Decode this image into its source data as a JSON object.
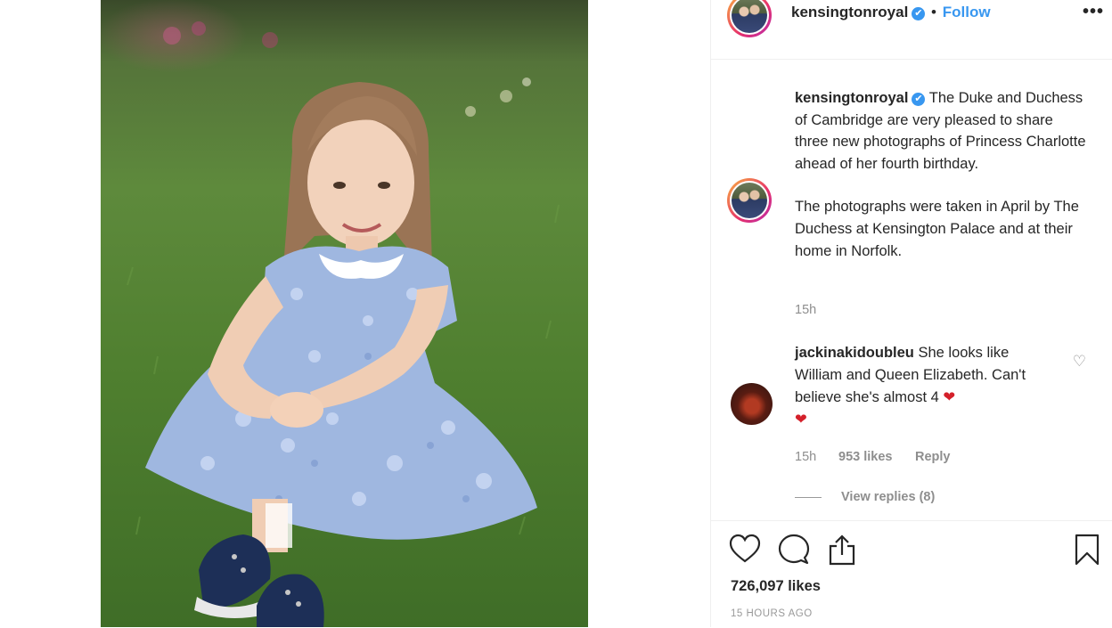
{
  "post": {
    "username": "kensingtonroyal",
    "verified_mark": "✔",
    "separator": "•",
    "follow_label": "Follow",
    "more_icon": "•••"
  },
  "caption": {
    "username": "kensingtonroyal",
    "paragraph1": "The Duke and Duchess of Cambridge are very pleased to share three new photographs of Princess Charlotte ahead of her fourth birthday.",
    "paragraph2": "The photographs were taken in April by The Duchess at Kensington Palace and at their home in Norfolk.",
    "time": "15h"
  },
  "comment": {
    "username": "jackinakidoubleu",
    "text": "She looks like William and Queen Elizabeth. Can't believe she's almost 4",
    "emoji": "❤",
    "emoji2": "❤",
    "time": "15h",
    "likes": "953 likes",
    "reply_label": "Reply",
    "view_replies": "View replies (8)",
    "like_icon": "♡"
  },
  "footer": {
    "likes": "726,097 likes",
    "timestamp": "15 HOURS AGO"
  },
  "colors": {
    "accent": "#3897f0",
    "muted": "#8e8e8e",
    "heart": "#d4202a"
  }
}
